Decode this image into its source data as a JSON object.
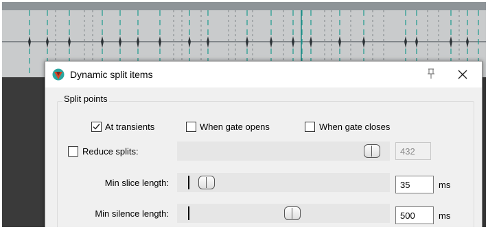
{
  "dialog": {
    "title": "Dynamic split items",
    "group_label": "Split points"
  },
  "checkboxes": [
    {
      "label": "At transients",
      "checked": true
    },
    {
      "label": "When gate opens",
      "checked": false
    },
    {
      "label": "When gate closes",
      "checked": false
    }
  ],
  "reduce_splits": {
    "label": "Reduce splits:",
    "checked": false,
    "value": "432",
    "slider_fraction": 0.95
  },
  "min_slice": {
    "label": "Min slice length:",
    "value": "35",
    "unit": "ms",
    "slider_fraction": 0.02
  },
  "min_silence": {
    "label": "Min silence length:",
    "value": "500",
    "unit": "ms",
    "slider_fraction": 0.5
  },
  "colors": {
    "accent_marker": "#1a9a8e",
    "reaper_red": "#d94327",
    "reaper_teal": "#2aa6a0"
  },
  "icons": {
    "app": "reaper-logo-icon",
    "pin": "pin-icon",
    "close": "close-icon",
    "check": "checkmark-icon"
  }
}
